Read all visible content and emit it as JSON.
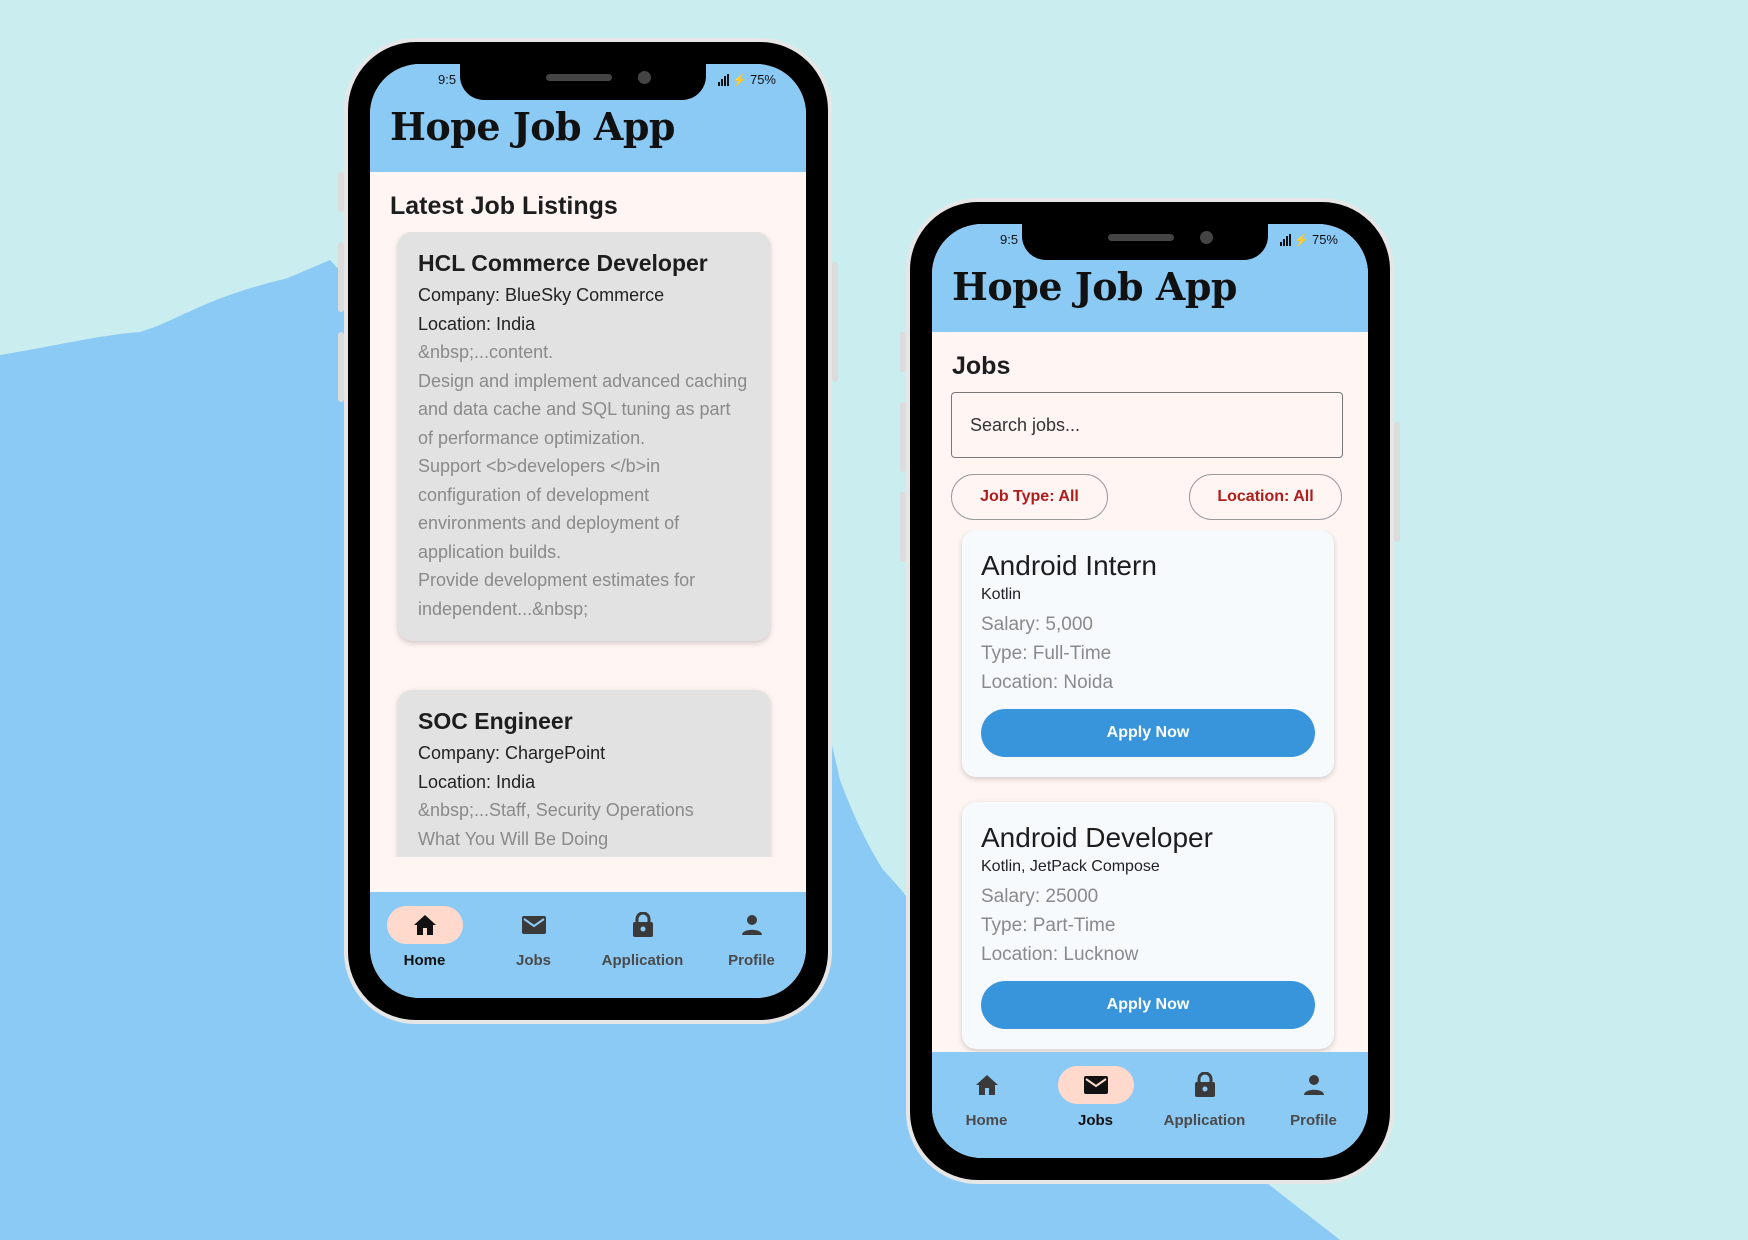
{
  "colors": {
    "background": "#caeef0",
    "blob": "#8ccaf6",
    "appbar": "#8ccaf6",
    "screen_bg": "#fff5f3",
    "active_nav_pill": "#ffd9cc",
    "apply_button": "#3995db",
    "filter_chip_text": "#b01c1c"
  },
  "left_phone": {
    "status": {
      "time": "9:5",
      "battery": "75%"
    },
    "app_title": "Hope Job App",
    "section_title": "Latest Job Listings",
    "listings": [
      {
        "title": "HCL Commerce Developer",
        "company": "Company: BlueSky Commerce",
        "location": "Location: India",
        "description": "&nbsp;...content.\n Design and implement advanced caching and data cache and SQL tuning as part of performance optimization.\n Support <b>developers </b>in configuration of development environments and deployment of application builds.\n Provide development estimates for independent...&nbsp;"
      },
      {
        "title": "SOC Engineer",
        "company": "Company: ChargePoint",
        "location": "Location: India",
        "description": "&nbsp;...Staff, Security Operations\n What You Will Be Doing\n Design, build, and maintain security"
      }
    ],
    "nav": [
      {
        "label": "Home",
        "icon": "home-icon",
        "active": true
      },
      {
        "label": "Jobs",
        "icon": "mail-icon",
        "active": false
      },
      {
        "label": "Application",
        "icon": "lock-icon",
        "active": false
      },
      {
        "label": "Profile",
        "icon": "person-icon",
        "active": false
      }
    ]
  },
  "right_phone": {
    "status": {
      "time": "9:5",
      "battery": "75%"
    },
    "app_title": "Hope Job App",
    "section_title": "Jobs",
    "search_placeholder": "Search jobs...",
    "filters": {
      "job_type": "Job Type: All",
      "location": "Location: All"
    },
    "jobs": [
      {
        "title": "Android Intern",
        "skills": "Kotlin",
        "salary": "Salary: 5,000",
        "type": "Type: Full-Time",
        "location": "Location: Noida",
        "apply_label": "Apply Now"
      },
      {
        "title": "Android Developer",
        "skills": "Kotlin, JetPack Compose",
        "salary": "Salary: 25000",
        "type": "Type: Part-Time",
        "location": "Location: Lucknow",
        "apply_label": "Apply Now"
      }
    ],
    "nav": [
      {
        "label": "Home",
        "icon": "home-icon",
        "active": false
      },
      {
        "label": "Jobs",
        "icon": "mail-icon",
        "active": true
      },
      {
        "label": "Application",
        "icon": "lock-icon",
        "active": false
      },
      {
        "label": "Profile",
        "icon": "person-icon",
        "active": false
      }
    ]
  }
}
